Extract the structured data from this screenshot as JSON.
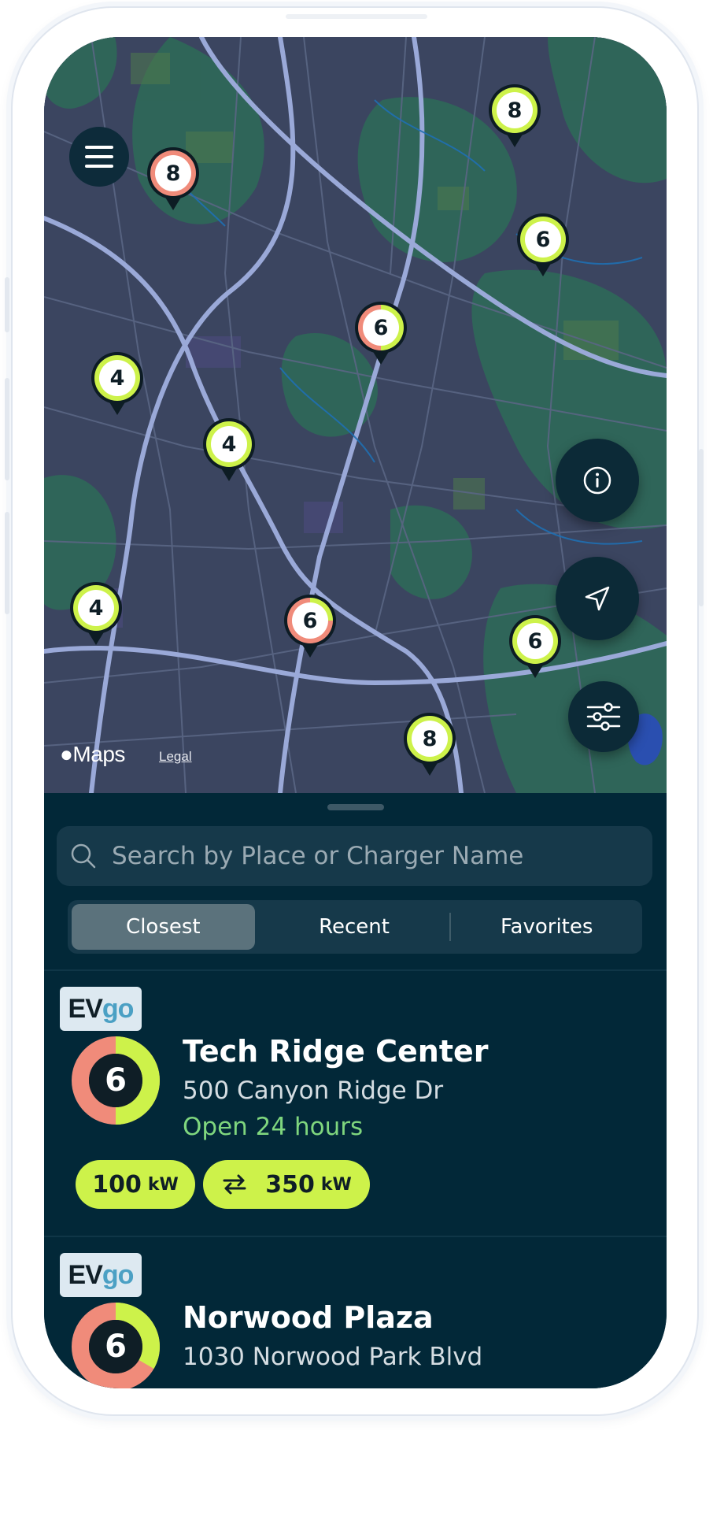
{
  "map": {
    "attribution_logo": "Maps",
    "legal_link": "Legal",
    "menu_icon": "hamburger-menu-icon",
    "fab_icons": [
      "info-icon",
      "location-arrow-icon",
      "filter-sliders-icon"
    ],
    "colors": {
      "pin_green": "#cdf24a",
      "pin_salmon": "#f08b7a"
    },
    "pins": [
      {
        "count": "8",
        "status": "available"
      },
      {
        "count": "8",
        "status": "busy"
      },
      {
        "count": "6",
        "status": "available"
      },
      {
        "count": "6",
        "status": "busy"
      },
      {
        "count": "4",
        "status": "available"
      },
      {
        "count": "4",
        "status": "available"
      },
      {
        "count": "4",
        "status": "available"
      },
      {
        "count": "6",
        "status": "partial"
      },
      {
        "count": "6",
        "status": "available"
      },
      {
        "count": "8",
        "status": "available"
      }
    ]
  },
  "sheet": {
    "search_placeholder": "Search by Place or Charger Name",
    "tabs": [
      {
        "label": "Closest",
        "active": true
      },
      {
        "label": "Recent",
        "active": false
      },
      {
        "label": "Favorites",
        "active": false
      }
    ]
  },
  "chargers": [
    {
      "network_ev": "EV",
      "network_go": "go",
      "available_count": "6",
      "available_fraction": 0.5,
      "name": "Tech Ridge Center",
      "address": "500 Canyon Ridge Dr",
      "hours": "Open 24 hours",
      "power_options": [
        {
          "value": "100",
          "unit": "kW",
          "icon": ""
        },
        {
          "value": "350",
          "unit": "kW",
          "icon": "swap-arrows-icon"
        }
      ]
    },
    {
      "network_ev": "EV",
      "network_go": "go",
      "available_count": "6",
      "available_fraction": 0.33,
      "name": "Norwood Plaza",
      "address": "1030 Norwood Park Blvd"
    }
  ]
}
